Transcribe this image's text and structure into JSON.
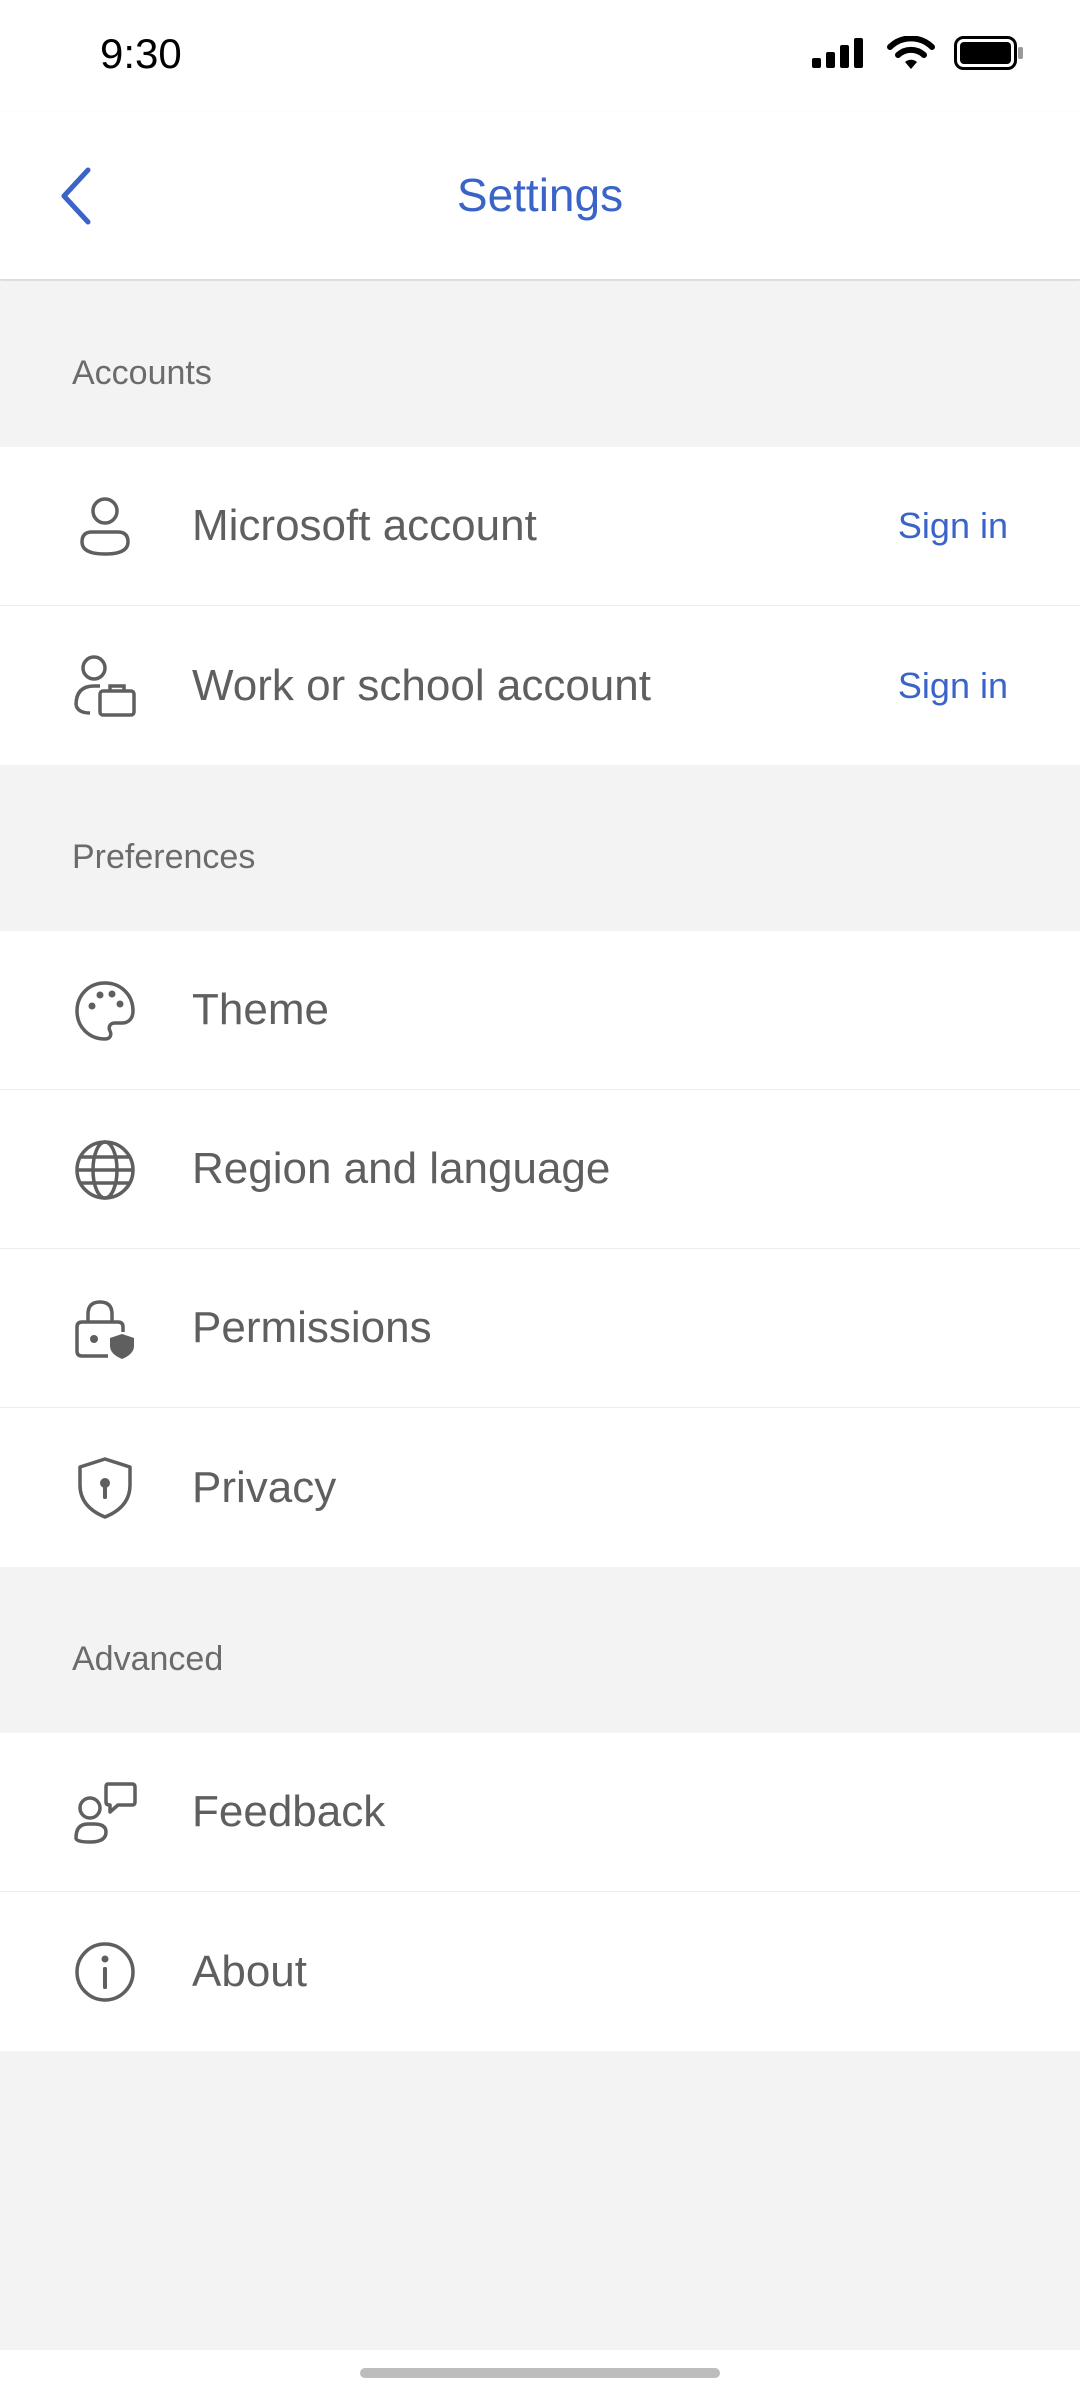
{
  "status_bar": {
    "time": "9:30"
  },
  "header": {
    "title": "Settings"
  },
  "sections": {
    "accounts": {
      "title": "Accounts",
      "items": [
        {
          "label": "Microsoft account",
          "action": "Sign in",
          "icon": "person-icon"
        },
        {
          "label": "Work or school account",
          "action": "Sign in",
          "icon": "person-briefcase-icon"
        }
      ]
    },
    "preferences": {
      "title": "Preferences",
      "items": [
        {
          "label": "Theme",
          "icon": "palette-icon"
        },
        {
          "label": "Region and language",
          "icon": "globe-icon"
        },
        {
          "label": "Permissions",
          "icon": "lock-shield-icon"
        },
        {
          "label": "Privacy",
          "icon": "shield-keyhole-icon"
        }
      ]
    },
    "advanced": {
      "title": "Advanced",
      "items": [
        {
          "label": "Feedback",
          "icon": "person-feedback-icon"
        },
        {
          "label": "About",
          "icon": "info-icon"
        }
      ]
    }
  },
  "colors": {
    "accent": "#3a64c8",
    "text": "#5f5f5f",
    "section_bg": "#f3f3f3"
  }
}
